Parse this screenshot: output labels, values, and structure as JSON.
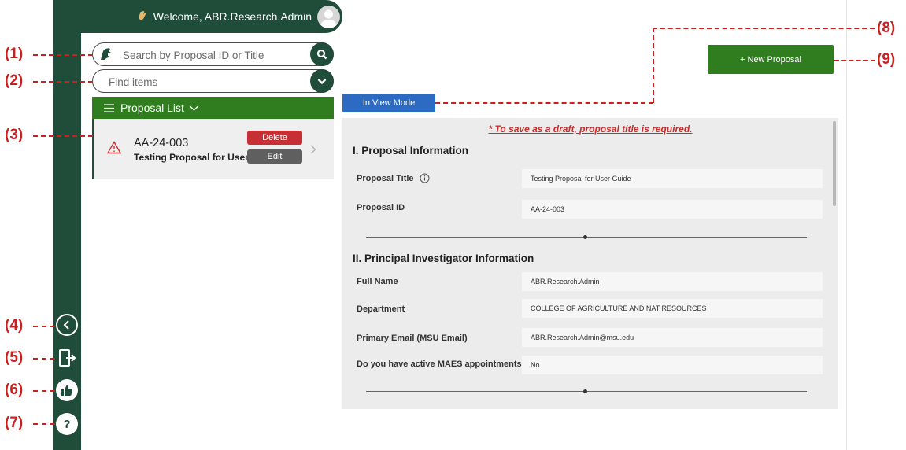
{
  "header": {
    "welcome_text": "Welcome, ABR.Research.Admin"
  },
  "search": {
    "placeholder": "Search by Proposal ID or Title"
  },
  "filter": {
    "placeholder": "Find items"
  },
  "proposal_list": {
    "title": "Proposal List",
    "items": [
      {
        "id": "AA-24-003",
        "title": "Testing Proposal for User",
        "delete_label": "Delete",
        "edit_label": "Edit"
      }
    ]
  },
  "mode_label": "In View Mode",
  "new_proposal_label": "+ New Proposal",
  "form": {
    "draft_notice": "* To save as a draft, proposal title is required.",
    "sections": [
      {
        "title": "I. Proposal Information",
        "fields": [
          {
            "label": "Proposal Title",
            "value": "Testing Proposal for User Guide"
          },
          {
            "label": "Proposal ID",
            "value": "AA-24-003"
          }
        ]
      },
      {
        "title": "II. Principal Investigator Information",
        "fields": [
          {
            "label": "Full Name",
            "value": "ABR.Research.Admin"
          },
          {
            "label": "Department",
            "value": "COLLEGE OF AGRICULTURE AND NAT RESOURCES"
          },
          {
            "label": "Primary Email (MSU Email)",
            "value": "ABR.Research.Admin@msu.edu"
          },
          {
            "label": "Do you have active MAES appointments?",
            "value": "No"
          }
        ]
      }
    ]
  },
  "callouts": [
    "(1)",
    "(2)",
    "(3)",
    "(4)",
    "(5)",
    "(6)",
    "(7)",
    "(8)",
    "(9)"
  ],
  "colors": {
    "brand_green": "#1f4d3a",
    "accent_green": "#2f7d1e",
    "mode_blue": "#2d6bc3",
    "delete_red": "#c62f34",
    "edit_gray": "#5f5f5f",
    "annotation_red": "#cc1f1f"
  }
}
